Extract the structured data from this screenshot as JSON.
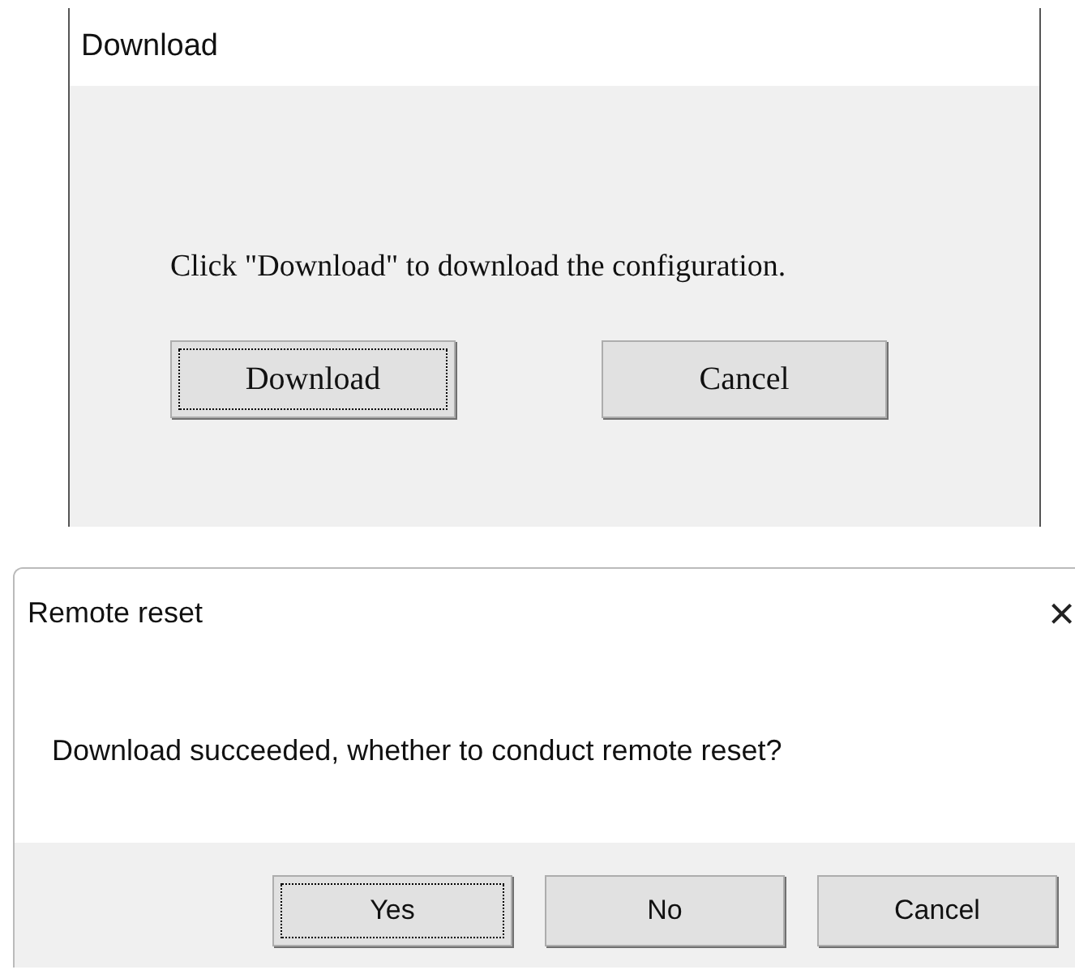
{
  "download_dialog": {
    "title": "Download",
    "message": "Click \"Download\" to download the configuration.",
    "buttons": [
      {
        "label": "Download",
        "focused": true
      },
      {
        "label": "Cancel",
        "focused": false
      }
    ]
  },
  "reset_dialog": {
    "title": "Remote reset",
    "close": "×",
    "message": "Download succeeded, whether to conduct remote reset?",
    "buttons": [
      {
        "label": "Yes",
        "focused": true
      },
      {
        "label": "No",
        "focused": false
      },
      {
        "label": "Cancel",
        "focused": false
      }
    ]
  }
}
